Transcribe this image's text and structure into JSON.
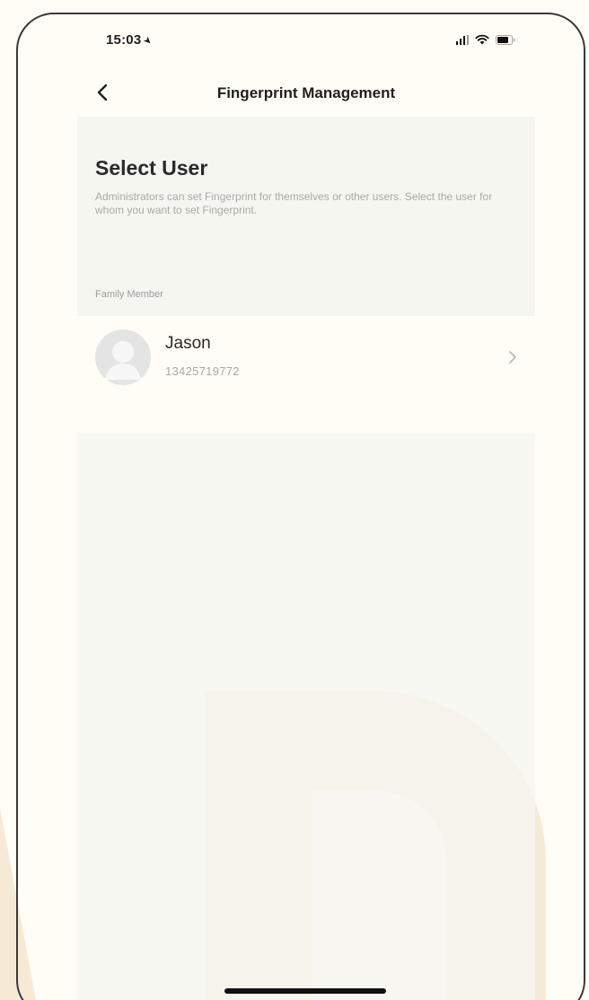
{
  "status_bar": {
    "time": "15:03",
    "location_icon": "location-arrow-icon",
    "signal_icon": "cellular-signal-icon",
    "wifi_icon": "wifi-icon",
    "battery_icon": "battery-icon"
  },
  "nav": {
    "back_icon": "chevron-left-icon",
    "title": "Fingerprint Management"
  },
  "header": {
    "title": "Select User",
    "description": "Administrators can set Fingerprint for themselves or other users. Select the user for whom you want to set Fingerprint."
  },
  "section": {
    "label": "Family Member"
  },
  "users": [
    {
      "name": "Jason",
      "phone": "13425719772",
      "avatar_icon": "default-avatar-icon",
      "chevron_icon": "chevron-right-icon"
    }
  ],
  "colors": {
    "background": "#fffdf5",
    "panel": "#f6f6f1",
    "text_primary": "#2a2a2a",
    "text_secondary": "#a8a8a8",
    "watermark": "#f6ead6"
  }
}
